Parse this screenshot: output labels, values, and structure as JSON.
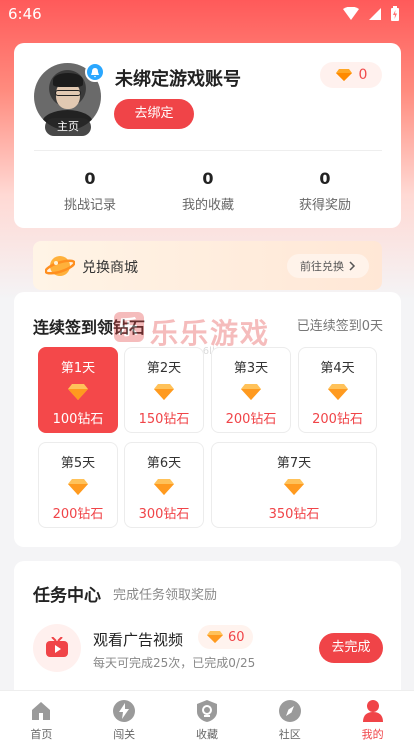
{
  "status": {
    "time": "6:46"
  },
  "profile": {
    "account_name": "未绑定游戏账号",
    "diamonds": "0",
    "home_tag": "主页",
    "unbind_label": "去绑定",
    "stats": [
      {
        "value": "0",
        "label": "挑战记录"
      },
      {
        "value": "0",
        "label": "我的收藏"
      },
      {
        "value": "0",
        "label": "获得奖励"
      }
    ]
  },
  "exchange": {
    "title": "兑换商城",
    "go_label": "前往兑换"
  },
  "signin": {
    "title": "连续签到领钻石",
    "subtitle": "已连续签到0天",
    "days": [
      {
        "label": "第1天",
        "reward": "100钻石"
      },
      {
        "label": "第2天",
        "reward": "150钻石"
      },
      {
        "label": "第3天",
        "reward": "200钻石"
      },
      {
        "label": "第4天",
        "reward": "200钻石"
      },
      {
        "label": "第5天",
        "reward": "200钻石"
      },
      {
        "label": "第6天",
        "reward": "300钻石"
      },
      {
        "label": "第7天",
        "reward": "350钻石"
      }
    ],
    "watermark": "乐乐游戏",
    "watermark_url": "www.6ll.com"
  },
  "task_center": {
    "title": "任务中心",
    "subtitle": "完成任务领取奖励",
    "task": {
      "name": "观看广告视频",
      "reward": "60",
      "desc": "每天可完成25次，已完成0/25",
      "button": "去完成"
    }
  },
  "tabbar": {
    "items": [
      {
        "label": "首页",
        "icon": "home-icon"
      },
      {
        "label": "闯关",
        "icon": "lightning-icon"
      },
      {
        "label": "收藏",
        "icon": "collect-icon"
      },
      {
        "label": "社区",
        "icon": "compass-icon"
      },
      {
        "label": "我的",
        "icon": "user-icon"
      }
    ],
    "active": "我的"
  },
  "colors": {
    "accent": "#f04448",
    "diamond": "#ff9a1f"
  }
}
